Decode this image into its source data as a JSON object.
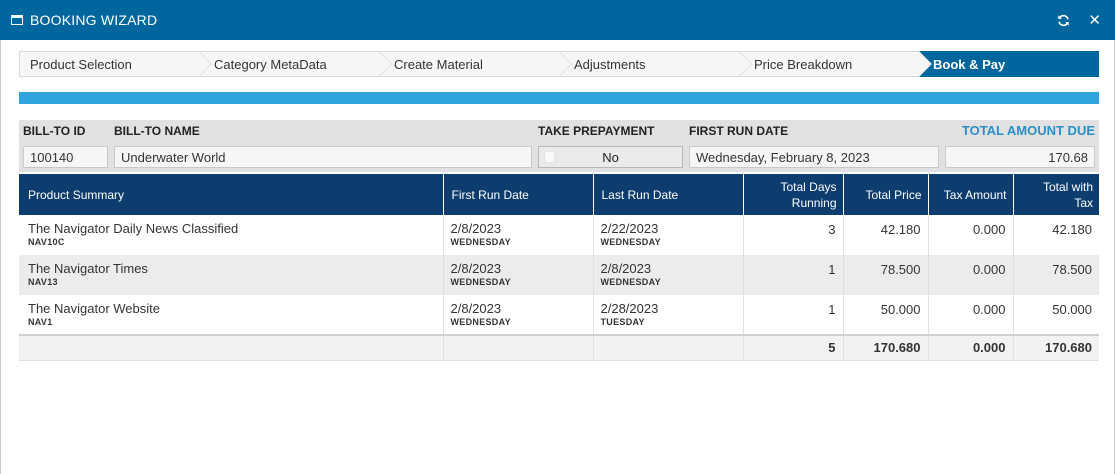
{
  "window": {
    "title": "BOOKING WIZARD"
  },
  "steps": [
    {
      "label": "Product Selection",
      "active": false
    },
    {
      "label": "Category MetaData",
      "active": false
    },
    {
      "label": "Create Material",
      "active": false
    },
    {
      "label": "Adjustments",
      "active": false
    },
    {
      "label": "Price Breakdown",
      "active": false
    },
    {
      "label": "Book & Pay",
      "active": true
    }
  ],
  "progress": {
    "percent": 100
  },
  "fields": {
    "bill_to_id_label": "BILL-TO ID",
    "bill_to_id": "100140",
    "bill_to_name_label": "BILL-TO NAME",
    "bill_to_name": "Underwater World",
    "prepayment_label": "TAKE PREPAYMENT",
    "prepayment_value": "No",
    "first_run_label": "FIRST RUN DATE",
    "first_run_value": "Wednesday, February 8, 2023",
    "total_label": "TOTAL AMOUNT DUE",
    "total_value": "170.68"
  },
  "table": {
    "headers": {
      "product": "Product Summary",
      "first_run": "First Run Date",
      "last_run": "Last Run Date",
      "days_line1": "Total Days",
      "days_line2": "Running",
      "price": "Total Price",
      "tax": "Tax Amount",
      "total_line1": "Total with",
      "total_line2": "Tax"
    },
    "rows": [
      {
        "name": "The Navigator Daily News Classified",
        "code": "NAV10C",
        "first_date": "2/8/2023",
        "first_day": "WEDNESDAY",
        "last_date": "2/22/2023",
        "last_day": "WEDNESDAY",
        "days": "3",
        "price": "42.180",
        "tax": "0.000",
        "total": "42.180"
      },
      {
        "name": "The Navigator Times",
        "code": "NAV13",
        "first_date": "2/8/2023",
        "first_day": "WEDNESDAY",
        "last_date": "2/8/2023",
        "last_day": "WEDNESDAY",
        "days": "1",
        "price": "78.500",
        "tax": "0.000",
        "total": "78.500"
      },
      {
        "name": "The Navigator Website",
        "code": "NAV1",
        "first_date": "2/8/2023",
        "first_day": "WEDNESDAY",
        "last_date": "2/28/2023",
        "last_day": "TUESDAY",
        "days": "1",
        "price": "50.000",
        "tax": "0.000",
        "total": "50.000"
      }
    ],
    "totals": {
      "days": "5",
      "price": "170.680",
      "tax": "0.000",
      "total": "170.680"
    }
  },
  "colors": {
    "titlebar": "#00679e",
    "progress": "#2ea4da",
    "table_header": "#0d3c6e",
    "accent_text": "#2990c8"
  }
}
